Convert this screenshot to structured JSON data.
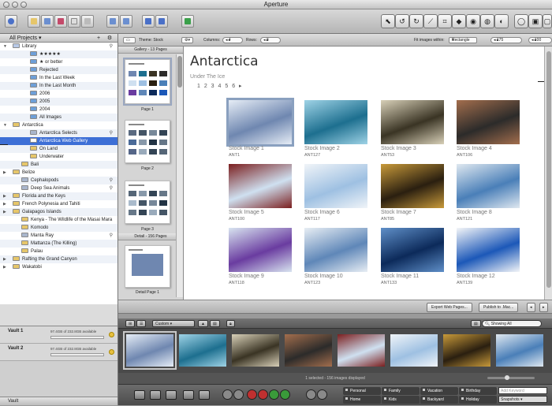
{
  "window": {
    "title": "Aperture"
  },
  "sidebar": {
    "header": "All Projects ▾",
    "header_add": "+",
    "header_gear": "⚙",
    "footer": "Vault",
    "items": [
      {
        "label": "Library",
        "indent": 0,
        "tri": "▼",
        "icon": "#b8c9e6",
        "mag": true
      },
      {
        "label": "★★★★★",
        "indent": 2,
        "icon": "#6d9fd8"
      },
      {
        "label": "★ or better",
        "indent": 2,
        "icon": "#6d9fd8"
      },
      {
        "label": "Rejected",
        "indent": 2,
        "icon": "#6d9fd8"
      },
      {
        "label": "In the Last Week",
        "indent": 2,
        "icon": "#6d9fd8"
      },
      {
        "label": "In the Last Month",
        "indent": 2,
        "icon": "#6d9fd8"
      },
      {
        "label": "2006",
        "indent": 2,
        "icon": "#6d9fd8"
      },
      {
        "label": "2005",
        "indent": 2,
        "icon": "#6d9fd8"
      },
      {
        "label": "2004",
        "indent": 2,
        "icon": "#6d9fd8"
      },
      {
        "label": "All Images",
        "indent": 2,
        "icon": "#6d9fd8"
      },
      {
        "label": "Antarctica",
        "indent": 0,
        "tri": "▼",
        "icon": "#e6c66a"
      },
      {
        "label": "Antarctica Selects",
        "indent": 2,
        "icon": "#a9b6cc",
        "mag": true
      },
      {
        "label": "Antarctica Web Gallery",
        "indent": 2,
        "icon": "#ffffff",
        "selected": true
      },
      {
        "label": "On Land",
        "indent": 2,
        "icon": "#e6c66a"
      },
      {
        "label": "Underwater",
        "indent": 2,
        "icon": "#e6c66a"
      },
      {
        "label": "Bali",
        "indent": 1,
        "icon": "#e6c66a"
      },
      {
        "label": "Belize",
        "indent": 0,
        "tri": "▶",
        "icon": "#e6c66a"
      },
      {
        "label": "Cephalopods",
        "indent": 1,
        "icon": "#a9b6cc",
        "mag": true
      },
      {
        "label": "Deep Sea Animals",
        "indent": 1,
        "icon": "#a9b6cc",
        "mag": true
      },
      {
        "label": "Florida and the Keys",
        "indent": 0,
        "tri": "▶",
        "icon": "#e6c66a"
      },
      {
        "label": "French Polynesia and Tahiti",
        "indent": 0,
        "tri": "▶",
        "icon": "#e6c66a"
      },
      {
        "label": "Galapagos Islands",
        "indent": 0,
        "tri": "▶",
        "icon": "#e6c66a"
      },
      {
        "label": "Kenya - The Wildlife of the Masai Mara",
        "indent": 1,
        "icon": "#e6c66a"
      },
      {
        "label": "Komodo",
        "indent": 1,
        "icon": "#e6c66a"
      },
      {
        "label": "Manta Ray",
        "indent": 1,
        "icon": "#a9b6cc",
        "mag": true
      },
      {
        "label": "Mattanza (The Killing)",
        "indent": 1,
        "icon": "#e6c66a"
      },
      {
        "label": "Palau",
        "indent": 1,
        "icon": "#e6c66a"
      },
      {
        "label": "Rafting the Grand Canyon",
        "indent": 0,
        "tri": "▶",
        "icon": "#e6c66a"
      },
      {
        "label": "Wakatobi",
        "indent": 0,
        "tri": "▶",
        "icon": "#e6c66a"
      }
    ]
  },
  "vaults": [
    {
      "name": "Vault 1",
      "available": "97.4GB of 232.8GB available"
    },
    {
      "name": "Vault 2",
      "available": "97.4GB of 232.8GB available"
    }
  ],
  "pathbar": {
    "theme": "Theme: Stock",
    "columns_label": "Columns:",
    "columns": "4",
    "rows_label": "Rows:",
    "rows": "3",
    "fit_label": "Fit images within:",
    "fit": "Rectangle",
    "w": "175",
    "h": "100"
  },
  "pages": {
    "gallery_header": "Gallery - 13 Pages",
    "detail_header": "Detail - 156 Pages",
    "page1": "Page 1",
    "page2": "Page 2",
    "page3": "Page 3",
    "detail1": "Detail Page 1"
  },
  "gallery": {
    "title": "Antarctica",
    "subtitle": "Under The Ice",
    "pagination": "1 2 3 4 5 6 ▸",
    "cells": [
      {
        "caption": "Stock Image 1",
        "id": "ANT1",
        "c1": "#6f87b0",
        "c2": "#e6edf6",
        "sel": true
      },
      {
        "caption": "Stock Image 2",
        "id": "ANT127",
        "c1": "#1d6f8f",
        "c2": "#9fd3e6"
      },
      {
        "caption": "Stock Image 3",
        "id": "ANT53",
        "c1": "#3a3424",
        "c2": "#d8d0b8"
      },
      {
        "caption": "Stock Image 4",
        "id": "ANT106",
        "c1": "#2c2b2a",
        "c2": "#a36e4d"
      },
      {
        "caption": "Stock Image 5",
        "id": "ANT100",
        "c1": "#cfe0f0",
        "c2": "#7b1f1f"
      },
      {
        "caption": "Stock Image 6",
        "id": "ANT117",
        "c1": "#9ec0e2",
        "c2": "#f0f4f8"
      },
      {
        "caption": "Stock Image 7",
        "id": "ANT85",
        "c1": "#2a1f10",
        "c2": "#c89a3a"
      },
      {
        "caption": "Stock Image 8",
        "id": "ANT121",
        "c1": "#4a7fb8",
        "c2": "#dfe8f0"
      },
      {
        "caption": "Stock Image 9",
        "id": "ANT118",
        "c1": "#6a3ca0",
        "c2": "#d8e4f0"
      },
      {
        "caption": "Stock Image 10",
        "id": "ANT123",
        "c1": "#5f87b8",
        "c2": "#e8eef4"
      },
      {
        "caption": "Stock Image 11",
        "id": "ANT133",
        "c1": "#0c2a5a",
        "c2": "#5f8fc8"
      },
      {
        "caption": "Stock Image 12",
        "id": "ANT139",
        "c1": "#1c58b8",
        "c2": "#f4f6f8"
      }
    ]
  },
  "actions": {
    "export": "Export Web Pages...",
    "publish": "Publish to .Mac..."
  },
  "browser": {
    "sort": "Custom",
    "search": "Showing All",
    "status": "1 selected - 156 images displayed",
    "film": [
      {
        "c1": "#6f87b0",
        "c2": "#e6edf6"
      },
      {
        "c1": "#1d6f8f",
        "c2": "#9fd3e6"
      },
      {
        "c1": "#3a3424",
        "c2": "#d8d0b8"
      },
      {
        "c1": "#2c2b2a",
        "c2": "#a36e4d"
      },
      {
        "c1": "#cfe0f0",
        "c2": "#7b1f1f"
      },
      {
        "c1": "#9ec0e2",
        "c2": "#f0f4f8"
      },
      {
        "c1": "#2a1f10",
        "c2": "#c89a3a"
      },
      {
        "c1": "#4a7fb8",
        "c2": "#dfe8f0"
      }
    ]
  },
  "keywords": {
    "row1": [
      "Personal",
      "Family",
      "Vacation",
      "Birthday"
    ],
    "row2": [
      "Home",
      "Kids",
      "Backyard",
      "Holiday"
    ],
    "add_placeholder": "Add Keyword",
    "set": "Snapshots"
  }
}
